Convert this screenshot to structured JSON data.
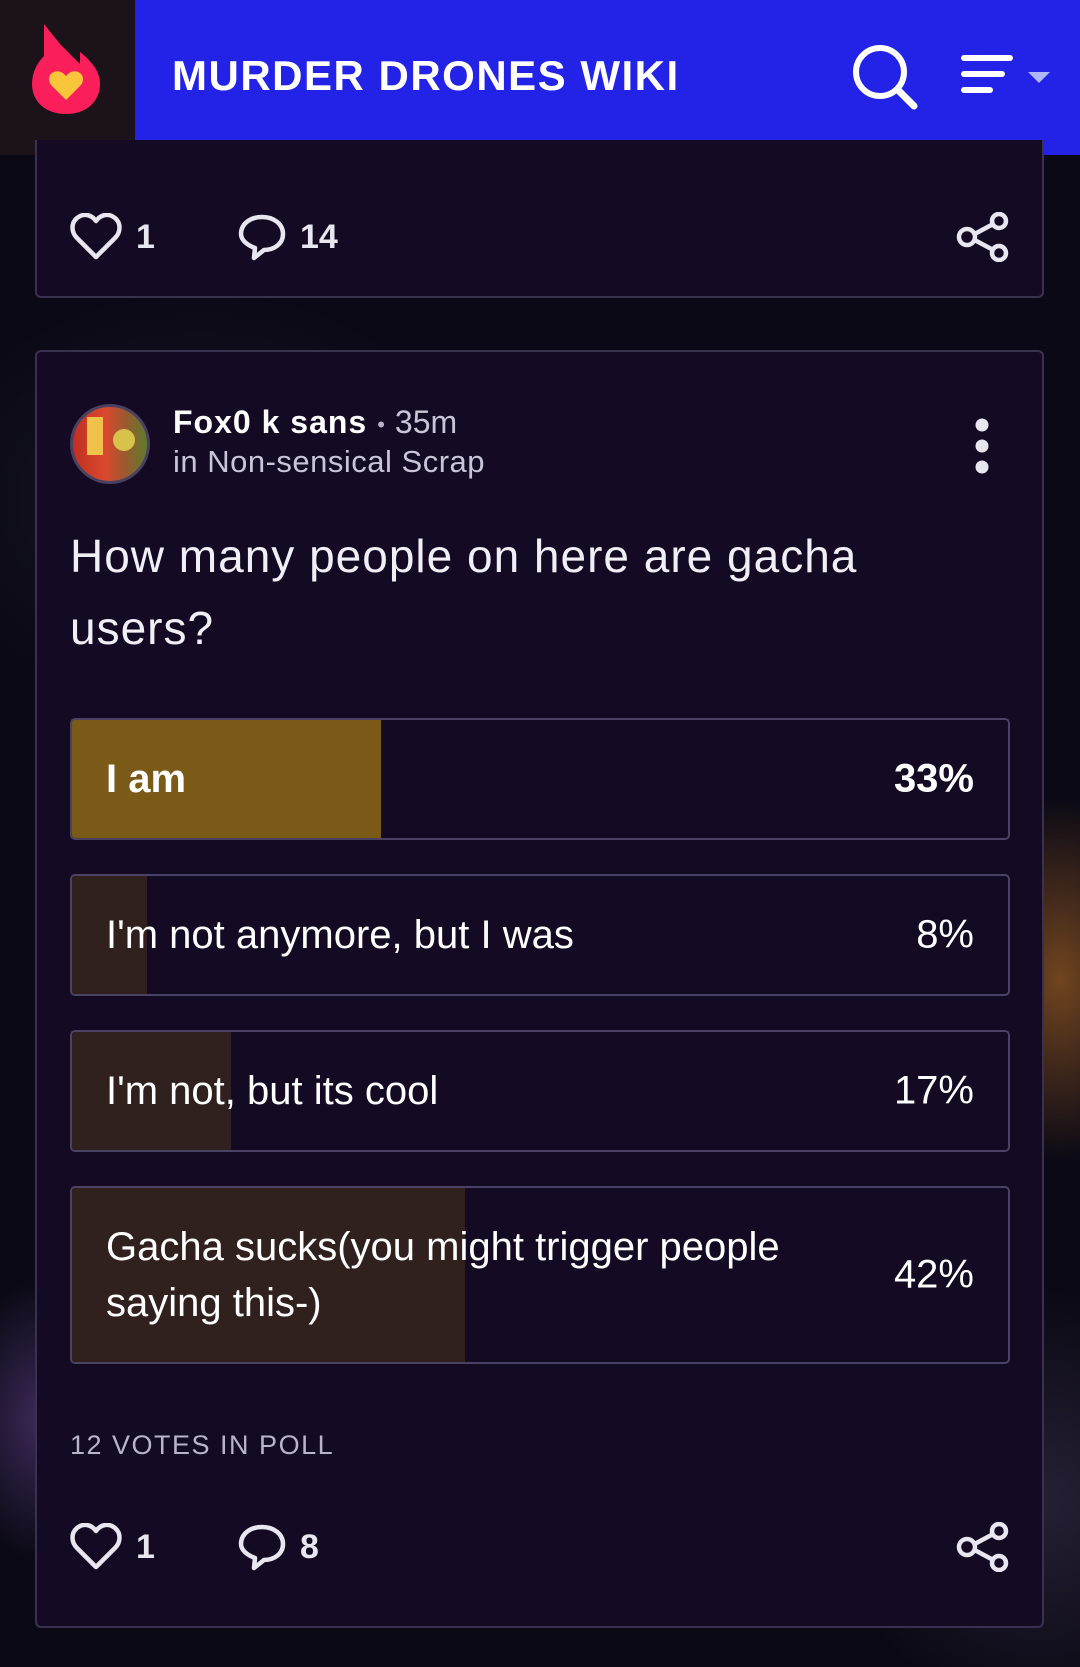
{
  "header": {
    "title": "MURDER DRONES WIKI",
    "logo_icon": "fandom-flame-heart-icon",
    "colors": {
      "bar": "#2323e8",
      "logo_bg": "#1c1219",
      "flame": "#fa1f5a",
      "heart": "#f9c53a"
    }
  },
  "previous_post": {
    "likes": "1",
    "comments": "14"
  },
  "post": {
    "author": "Fox0 k sans",
    "time": "35m",
    "community": "in Non-sensical Scrap",
    "question": "How many people on here are gacha users?",
    "options": [
      {
        "label": "I am",
        "percent": "33%",
        "value": 33,
        "winner": true,
        "fill_color": "#7a5a16"
      },
      {
        "label": "I'm not anymore, but I was",
        "percent": "8%",
        "value": 8,
        "winner": false,
        "fill_color": "#30211f"
      },
      {
        "label": "I'm not, but its cool",
        "percent": "17%",
        "value": 17,
        "winner": false,
        "fill_color": "#30211f"
      },
      {
        "label": "Gacha sucks(you might trigger people saying this-)",
        "percent": "42%",
        "value": 42,
        "winner": false,
        "fill_color": "#30211f"
      }
    ],
    "votes_text": "12 VOTES IN POLL",
    "likes": "1",
    "comments": "8"
  }
}
